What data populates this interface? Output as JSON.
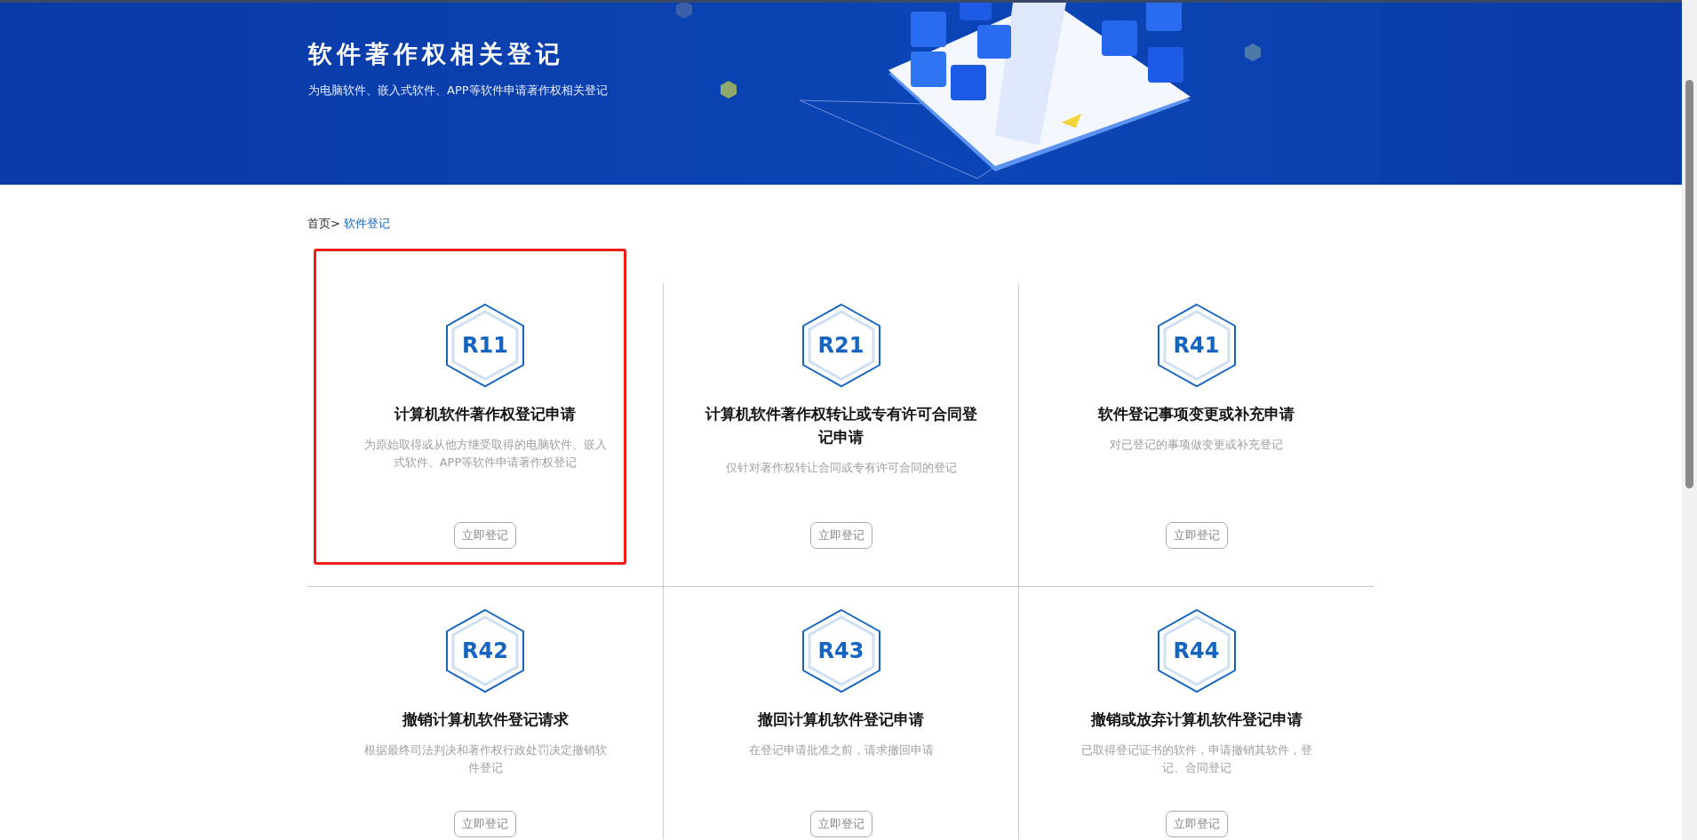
{
  "banner": {
    "title": "软件著作权相关登记",
    "subtitle": "为电脑软件、嵌入式软件、APP等软件申请著作权相关登记"
  },
  "breadcrumb": [
    {
      "label": "首页>",
      "current": false
    },
    {
      "label": "软件登记",
      "current": true
    }
  ],
  "cards": [
    {
      "code": "R11",
      "title": "计算机软件著作权登记申请",
      "description": "为原始取得或从他方继受取得的电脑软件、嵌入式软件、APP等软件申请著作权登记",
      "button": "立即登记",
      "highlighted": true
    },
    {
      "code": "R21",
      "title": "计算机软件著作权转让或专有许可合同登记申请",
      "description": "仅针对著作权转让合同或专有许可合同的登记",
      "button": "立即登记",
      "highlighted": false
    },
    {
      "code": "R41",
      "title": "软件登记事项变更或补充申请",
      "description": "对已登记的事项做变更或补充登记",
      "button": "立即登记",
      "highlighted": false
    },
    {
      "code": "R42",
      "title": "撤销计算机软件登记请求",
      "description": "根据最终司法判决和著作权行政处罚决定撤销软件登记",
      "button": "立即登记",
      "highlighted": false
    },
    {
      "code": "R43",
      "title": "撤回计算机软件登记申请",
      "description": "在登记申请批准之前，请求撤回申请",
      "button": "立即登记",
      "highlighted": false
    },
    {
      "code": "R44",
      "title": "撤销或放弃计算机软件登记申请",
      "description": "已取得登记证书的软件，申请撤销其软件，登记、合同登记",
      "button": "立即登记",
      "highlighted": false
    }
  ]
}
